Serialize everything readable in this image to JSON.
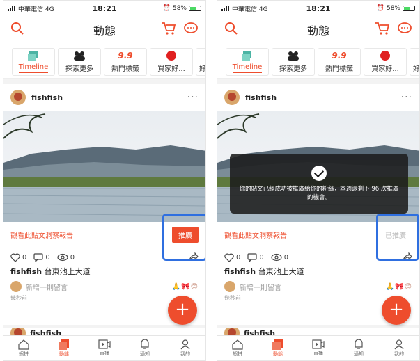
{
  "status": {
    "carrier": "中華電信 4G",
    "time": "18:21",
    "battery": "58%"
  },
  "header": {
    "title": "動態"
  },
  "tabs": [
    {
      "label": "Timeline",
      "icon": "timeline-icon",
      "active": true
    },
    {
      "label": "探索更多",
      "icon": "people-icon"
    },
    {
      "label": "熱門標籤",
      "icon": "hot-tag-icon",
      "badge": "9.9"
    },
    {
      "label": "買家好...",
      "icon": "red-dot-icon"
    },
    {
      "label": "好康"
    }
  ],
  "post": {
    "username": "fishfish",
    "more": "···",
    "insight_link": "觀看此貼文洞察報告",
    "promote_label": "推廣",
    "promoted_label": "已推廣",
    "likes": "0",
    "comments": "0",
    "views": "0",
    "caption_user": "fishfish",
    "caption_text": "台東池上大道",
    "comment_placeholder": "新增一則留言",
    "time_ago": "幾秒前",
    "next_username": "fishfish"
  },
  "toast": {
    "message": "你的貼文已經成功被推廣給你的粉絲，本週還剩下 96 次推廣的機會。"
  },
  "fab": {
    "label": "+"
  },
  "bottom_nav": [
    {
      "label": "蝦拼",
      "icon": "home-icon"
    },
    {
      "label": "動態",
      "icon": "feed-icon",
      "active": true
    },
    {
      "label": "直播",
      "icon": "live-icon"
    },
    {
      "label": "通知",
      "icon": "bell-icon"
    },
    {
      "label": "我的",
      "icon": "profile-icon"
    }
  ],
  "colors": {
    "accent": "#ee4d2d",
    "highlight": "#2f6fe0"
  }
}
